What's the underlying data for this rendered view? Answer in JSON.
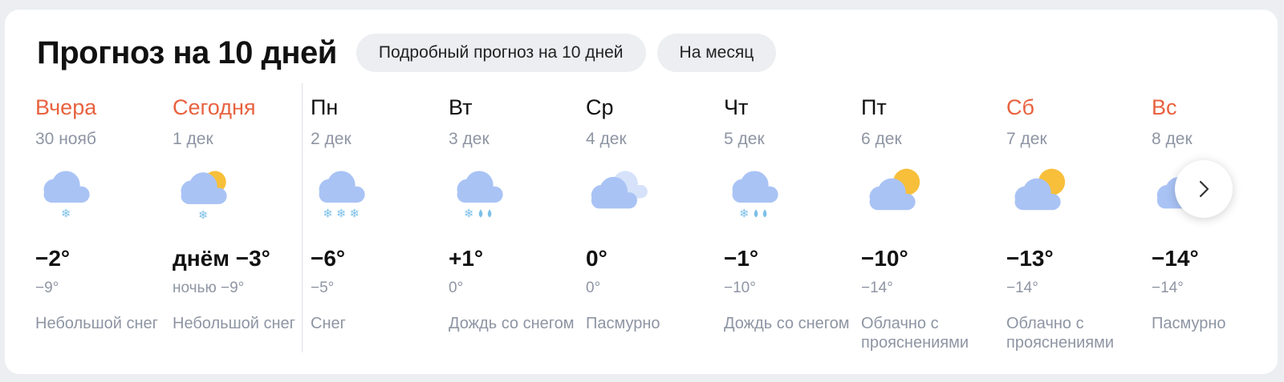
{
  "header": {
    "title": "Прогноз на 10 дней",
    "btn_detailed": "Подробный прогноз на 10 дней",
    "btn_month": "На месяц"
  },
  "colors": {
    "weekend": "#e8623f",
    "muted": "#8e95a3",
    "cloud": "#a9c3f5",
    "sun": "#f7bf3a",
    "precip": "#7cc0e8"
  },
  "days": [
    {
      "name": "Вчера",
      "date": "30 нояб",
      "day_temp": "−2°",
      "night_temp": "−9°",
      "condition": "Небольшой снег",
      "icon": "cloud-light-snow-icon",
      "red": true
    },
    {
      "name": "Сегодня",
      "date": "1 дек",
      "day_temp": "днём −3°",
      "night_temp": "ночью −9°",
      "condition": "Небольшой снег",
      "icon": "sun-cloud-snow-icon",
      "red": true
    },
    {
      "name": "Пн",
      "date": "2 дек",
      "day_temp": "−6°",
      "night_temp": "−5°",
      "condition": "Снег",
      "icon": "cloud-snow-icon",
      "red": false
    },
    {
      "name": "Вт",
      "date": "3 дек",
      "day_temp": "+1°",
      "night_temp": "0°",
      "condition": "Дождь со снегом",
      "icon": "cloud-sleet-icon",
      "red": false
    },
    {
      "name": "Ср",
      "date": "4 дек",
      "day_temp": "0°",
      "night_temp": "0°",
      "condition": "Пасмурно",
      "icon": "overcast-icon",
      "red": false
    },
    {
      "name": "Чт",
      "date": "5 дек",
      "day_temp": "−1°",
      "night_temp": "−10°",
      "condition": "Дождь со снегом",
      "icon": "cloud-sleet-icon",
      "red": false
    },
    {
      "name": "Пт",
      "date": "6 дек",
      "day_temp": "−10°",
      "night_temp": "−14°",
      "condition": "Облачно с прояснениями",
      "icon": "partly-cloudy-icon",
      "red": false
    },
    {
      "name": "Сб",
      "date": "7 дек",
      "day_temp": "−13°",
      "night_temp": "−14°",
      "condition": "Облачно с прояснениями",
      "icon": "partly-cloudy-icon",
      "red": true
    },
    {
      "name": "Вс",
      "date": "8 дек",
      "day_temp": "−14°",
      "night_temp": "−14°",
      "condition": "Пасмурно",
      "icon": "overcast-icon",
      "red": true
    }
  ],
  "next_button_icon": "chevron-right-icon"
}
